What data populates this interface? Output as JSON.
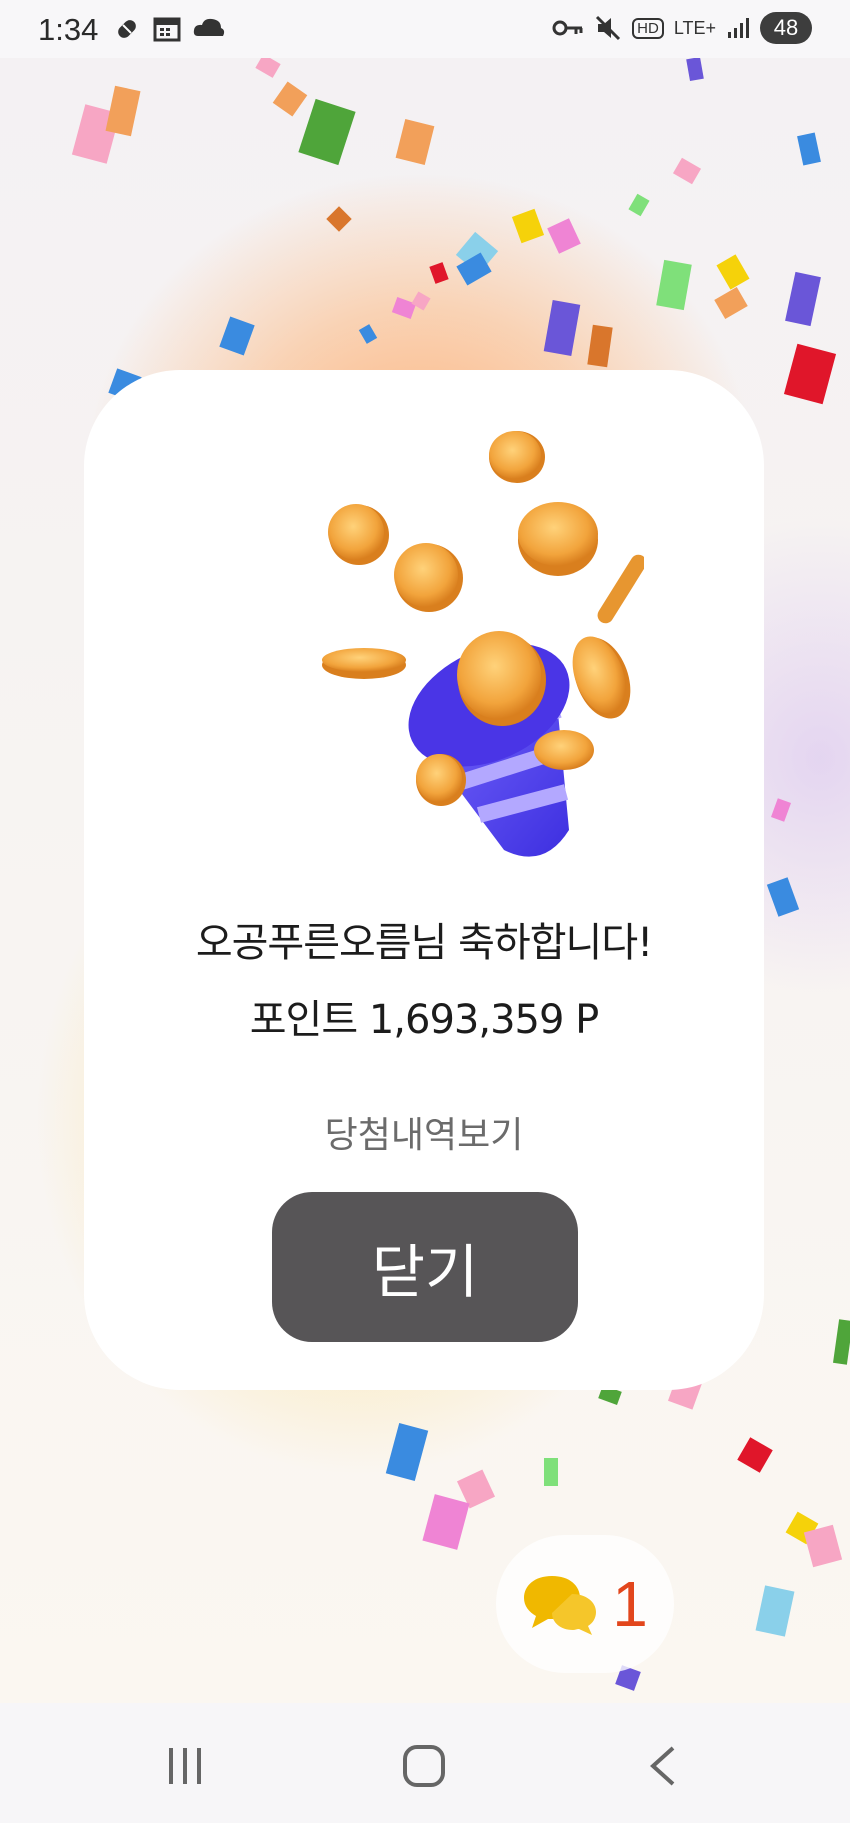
{
  "status_bar": {
    "time": "1:34",
    "network": "LTE+",
    "hd": "HD",
    "battery": "48",
    "left_icons": [
      "pill-icon",
      "calendar-icon",
      "cloud-app-icon"
    ],
    "right_icons": [
      "vpn-key-icon",
      "mute-icon",
      "hd-voice-icon",
      "lte-icon",
      "signal-icon",
      "battery-icon"
    ]
  },
  "dialog": {
    "congrats_text": "오공푸른오름님 축하합니다!",
    "points_text": "포인트 1,693,359 P",
    "history_link": "당첨내역보기",
    "close_label": "닫기",
    "illustration_icon": "coin-party-popper-icon"
  },
  "chat": {
    "icon": "chat-bubbles-icon",
    "count": "1"
  },
  "nav_bar": {
    "buttons": [
      "recent-apps-icon",
      "home-icon",
      "back-icon"
    ]
  },
  "colors": {
    "close_button_bg": "#575557",
    "chat_count": "#e2461c",
    "coin": "#f0a43a",
    "popper": "#6d5df0"
  }
}
